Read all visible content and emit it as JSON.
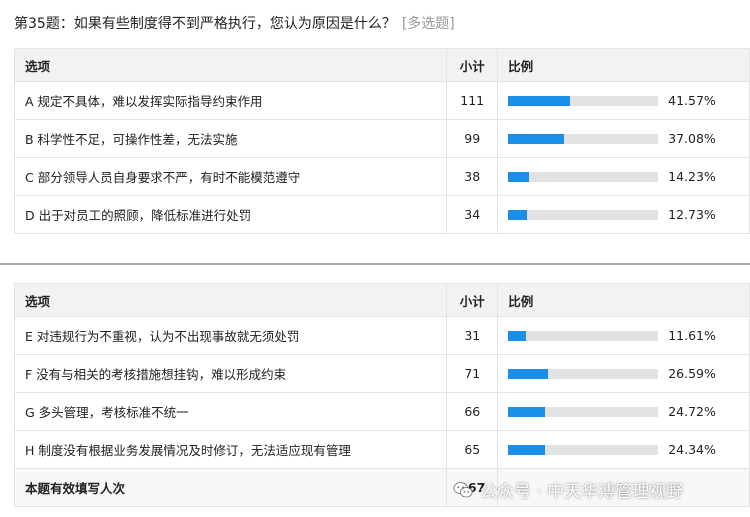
{
  "question": {
    "title": "第35题：如果有些制度得不到严格执行，您认为原因是什么？",
    "type_tag": "[多选题]"
  },
  "table_headers": {
    "option": "选项",
    "count": "小计",
    "ratio": "比例"
  },
  "tables": [
    {
      "rows": [
        {
          "option": "A 规定不具体，难以发挥实际指导约束作用",
          "count": "111",
          "percent": "41.57%",
          "fraction": 0.4157
        },
        {
          "option": "B 科学性不足，可操作性差，无法实施",
          "count": "99",
          "percent": "37.08%",
          "fraction": 0.3708
        },
        {
          "option": "C 部分领导人员自身要求不严，有时不能模范遵守",
          "count": "38",
          "percent": "14.23%",
          "fraction": 0.1423
        },
        {
          "option": "D 出于对员工的照顾，降低标准进行处罚",
          "count": "34",
          "percent": "12.73%",
          "fraction": 0.1273
        }
      ]
    },
    {
      "rows": [
        {
          "option": "E 对违规行为不重视，认为不出现事故就无须处罚",
          "count": "31",
          "percent": "11.61%",
          "fraction": 0.1161
        },
        {
          "option": "F 没有与相关的考核措施想挂钩，难以形成约束",
          "count": "71",
          "percent": "26.59%",
          "fraction": 0.2659
        },
        {
          "option": "G 多头管理，考核标准不统一",
          "count": "66",
          "percent": "24.72%",
          "fraction": 0.2472
        },
        {
          "option": "H 制度没有根据业务发展情况及时修订，无法适应现有管理",
          "count": "65",
          "percent": "24.34%",
          "fraction": 0.2434
        }
      ]
    }
  ],
  "total": {
    "label": "本题有效填写人次",
    "count": "267"
  },
  "watermark": {
    "text": "公众号 · 中天华溥管理视野",
    "icon": "wechat-icon"
  },
  "colors": {
    "bar_fill": "#1a8fe8",
    "bar_track": "#e2e2e2",
    "header_bg": "#f2f2f2"
  }
}
